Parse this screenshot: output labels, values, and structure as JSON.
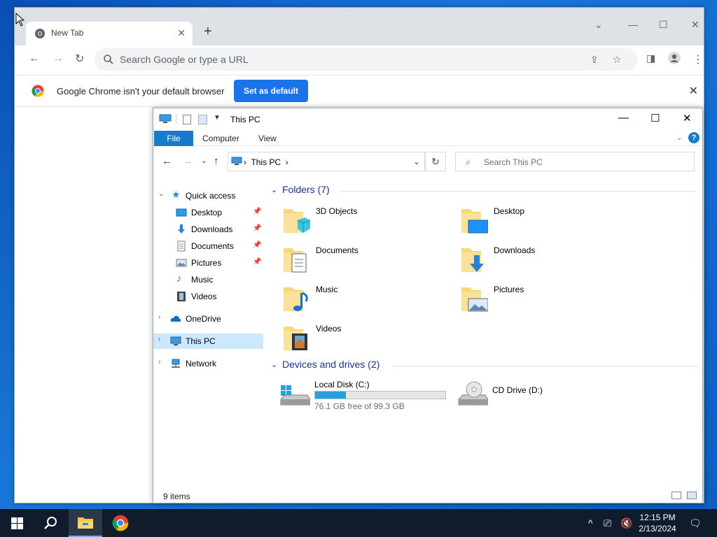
{
  "colors": {
    "accent": "#1979ca",
    "chrome_blue": "#1a73e8",
    "drive_bar": "#26a0da",
    "group_header": "#1e3287",
    "taskbar": "#101b2b"
  },
  "chrome": {
    "tab_title": "New Tab",
    "omnibox_placeholder": "Search Google or type a URL",
    "infobar_text": "Google Chrome isn't your default browser",
    "set_default_label": "Set as default"
  },
  "explorer": {
    "window_title": "This PC",
    "ribbon": {
      "file": "File",
      "computer": "Computer",
      "view": "View"
    },
    "address_crumb": "This PC",
    "search_placeholder": "Search This PC",
    "nav_pane": {
      "quick_access": "Quick access",
      "items": [
        {
          "label": "Desktop",
          "icon": "desktop-icon",
          "pinned": true
        },
        {
          "label": "Downloads",
          "icon": "downloads-icon",
          "pinned": true
        },
        {
          "label": "Documents",
          "icon": "documents-icon",
          "pinned": true
        },
        {
          "label": "Pictures",
          "icon": "pictures-icon",
          "pinned": true
        },
        {
          "label": "Music",
          "icon": "music-icon",
          "pinned": false
        },
        {
          "label": "Videos",
          "icon": "videos-icon",
          "pinned": false
        }
      ],
      "onedrive": "OneDrive",
      "this_pc": "This PC",
      "network": "Network"
    },
    "folders_header": "Folders (7)",
    "folders": [
      {
        "name": "3D Objects",
        "icon": "3d-objects-folder-icon"
      },
      {
        "name": "Desktop",
        "icon": "desktop-folder-icon"
      },
      {
        "name": "Documents",
        "icon": "documents-folder-icon"
      },
      {
        "name": "Downloads",
        "icon": "downloads-folder-icon"
      },
      {
        "name": "Music",
        "icon": "music-folder-icon"
      },
      {
        "name": "Pictures",
        "icon": "pictures-folder-icon"
      },
      {
        "name": "Videos",
        "icon": "videos-folder-icon"
      }
    ],
    "drives_header": "Devices and drives (2)",
    "drives": [
      {
        "name": "Local Disk (C:)",
        "free_text": "76.1 GB free of 99.3 GB",
        "used_fraction": 0.234
      },
      {
        "name": "CD Drive (D:)"
      }
    ],
    "status_items": "9 items"
  },
  "taskbar": {
    "time": "12:15 PM",
    "date": "2/13/2024"
  }
}
